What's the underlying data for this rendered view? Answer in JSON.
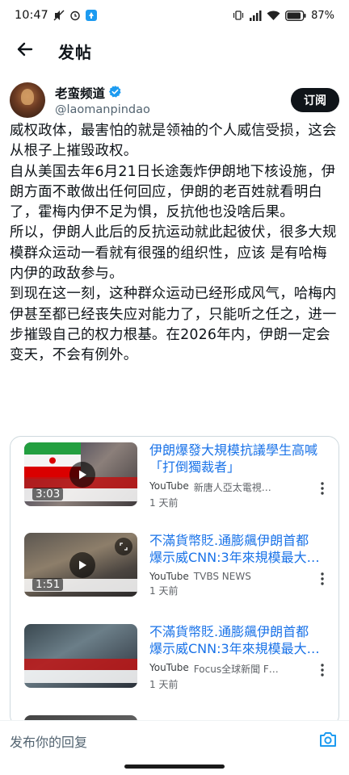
{
  "status_bar": {
    "time": "10:47",
    "battery": "87%"
  },
  "header": {
    "title": "发帖"
  },
  "author": {
    "name": "老蛮频道",
    "handle": "@laomanpindao",
    "subscribe_label": "订阅"
  },
  "post": {
    "paragraphs": [
      "威权政体，最害怕的就是领袖的个人威信受损，这会从根子上摧毁政权。",
      "自从美国去年6月21日长途轰炸伊朗地下核设施，伊朗方面不敢做出任何回应，伊朗的老百姓就看明白了，霍梅内伊不足为惧，反抗他也没啥后果。",
      "所以，伊朗人此后的反抗运动就此起彼伏，很多大规模群众运动一看就有很强的组织性，应该 是有哈梅内伊的政敌参与。",
      "到现在这一刻，这种群众运动已经形成风气，哈梅内伊甚至都已经丧失应对能力了，只能听之任之，进一步摧毁自己的权力根基。在2026年内，伊朗一定会变天，不会有例外。"
    ]
  },
  "cards": [
    {
      "title": "伊朗爆發大規模抗議學生高喊「打倒獨裁者」",
      "platform": "YouTube",
      "source": "新唐人亞太電視…",
      "time": "1 天前",
      "duration": "3:03"
    },
    {
      "title": "不滿貨幣貶.通膨飆伊朗首都爆示威CNN:3年來規模最大…",
      "platform": "YouTube",
      "source": "TVBS NEWS",
      "time": "1 天前",
      "duration": "1:51"
    },
    {
      "title": "不滿貨幣貶.通膨飆伊朗首都爆示威CNN:3年來規模最大…",
      "platform": "YouTube",
      "source": "Focus全球新聞 F…",
      "time": "1 天前",
      "duration": ""
    }
  ],
  "reply": {
    "placeholder": "发布你的回复"
  },
  "icons": {
    "back": "arrow-left-icon",
    "verified": "verified-badge-icon",
    "play": "play-icon",
    "more": "more-vertical-icon",
    "camera": "camera-icon"
  },
  "colors": {
    "link": "#1a73e8",
    "subscribe_bg": "#0f1419",
    "verified": "#1d9bf0",
    "camera": "#1d9bf0"
  }
}
